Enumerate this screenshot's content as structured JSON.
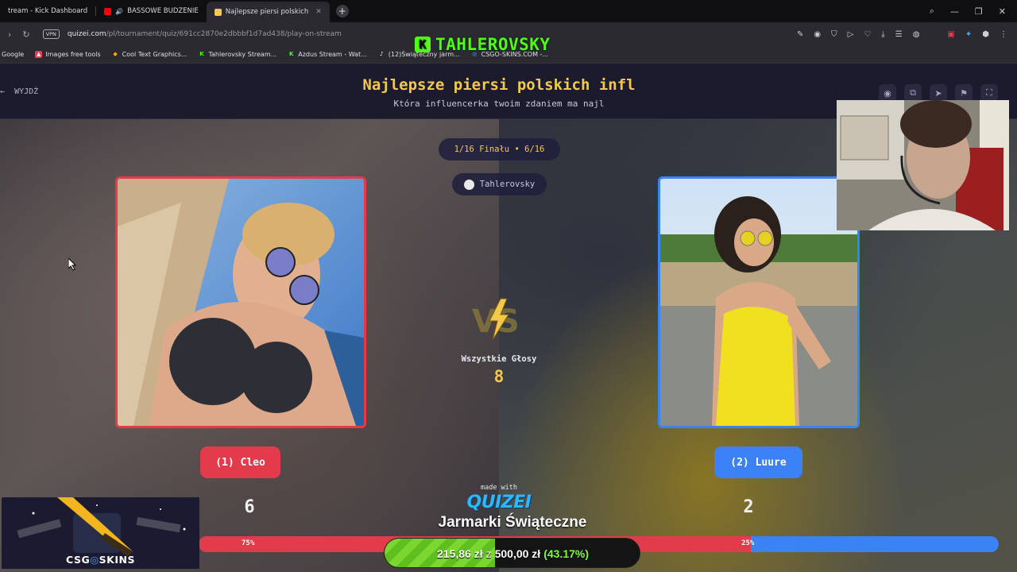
{
  "browser": {
    "tabs": [
      {
        "label": "tream - Kick Dashboard",
        "color": "#53fc18",
        "active": false
      },
      {
        "label": "BASSOWE BUDZENIE",
        "color": "#ff0000",
        "active": false
      },
      {
        "label": "Najlepsze piersi polskich",
        "color": "#f2c94c",
        "active": true
      }
    ],
    "new_tab": "+",
    "url_host": "quizei.com",
    "url_path": "/pl/tournament/quiz/691cc2870e2dbbbf1d7ad438/play-on-stream",
    "vpn_label": "VPN",
    "bookmarks": [
      {
        "label": "Google",
        "color": "#4285f4",
        "glyph": "G"
      },
      {
        "label": "Images free tools",
        "color": "#e33b4c",
        "glyph": "▲"
      },
      {
        "label": "Cool Text Graphics...",
        "color": "#ffb000",
        "glyph": "◆"
      },
      {
        "label": "Tahlerovsky Stream...",
        "color": "#53fc18",
        "glyph": "K"
      },
      {
        "label": "Azdus Stream - Wat...",
        "color": "#53fc18",
        "glyph": "K"
      },
      {
        "label": "(12)Świąteczny jarm...",
        "color": "#111111",
        "glyph": "♪"
      },
      {
        "label": "CSGO-SKINS.COM -...",
        "color": "#3ea6ff",
        "glyph": "◎"
      }
    ]
  },
  "stream_overlay": {
    "channel_name": "TAHLEROVSKY",
    "csg_brand": [
      "CSG",
      "SKINS"
    ],
    "donation_title": "Jarmarki Świąteczne",
    "donation_current": "215,86 zł",
    "donation_sep": "z",
    "donation_goal": "500,00 zł",
    "donation_percent_text": "(43.17%)",
    "donation_fraction": 0.4317
  },
  "page": {
    "exit_label": "WYJDŹ",
    "title": "Najlepsze piersi polskich infl",
    "subtitle": "Która influencerka twoim zdaniem ma najl",
    "round": "1/16 Finału • 6/16",
    "streamer": "Tahlerovsky",
    "total_votes_label": "Wszystkie Głosy",
    "total_votes": "8",
    "made_with": "made with",
    "logo_text": "QUIZEI",
    "left": {
      "name": "(1) Cleo",
      "votes": "6",
      "percent_label": "75%",
      "fraction": 0.75,
      "color": "#e33b4c"
    },
    "right": {
      "name": "(2) Luure",
      "votes": "2",
      "percent_label": "25%",
      "fraction": 0.25,
      "color": "#3b82f6"
    }
  },
  "icons": {
    "header": [
      "eye-icon",
      "share-icon",
      "send-icon",
      "flag-icon",
      "fullscreen-icon"
    ],
    "address": [
      "edit-icon",
      "camera-icon",
      "shield-icon",
      "play-icon",
      "heart-icon",
      "download-icon",
      "menu-icon",
      "profile-icon"
    ]
  }
}
